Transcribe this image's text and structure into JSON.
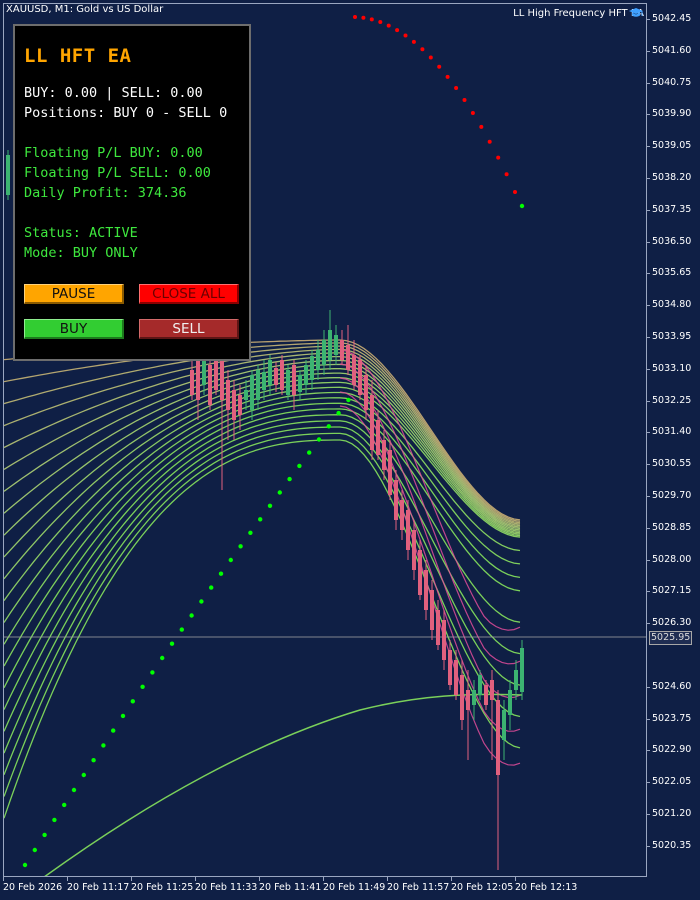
{
  "chart": {
    "title": "XAUUSD, M1:  Gold vs US Dollar",
    "ea_name": "LL High Frequency HFT EA",
    "ea_icon": "graduation-cap-icon",
    "current_price": "5025.95",
    "colors": {
      "background": "#0f1f45",
      "bull_candle": "#3cb371",
      "bear_candle": "#e0607e",
      "buy_dots": "#00ff00",
      "sell_dots": "#ff0000",
      "ribbon_green": "#7ad05a",
      "ribbon_tan": "#b8a070",
      "ribbon_pink": "#e04c9a"
    },
    "price_axis": [
      "5042.45",
      "5041.60",
      "5040.75",
      "5039.90",
      "5039.05",
      "5038.20",
      "5037.35",
      "5036.50",
      "5035.65",
      "5034.80",
      "5033.95",
      "5033.10",
      "5032.25",
      "5031.40",
      "5030.55",
      "5029.70",
      "5028.85",
      "5028.00",
      "5027.15",
      "5026.30",
      "5024.60",
      "5023.75",
      "5022.90",
      "5022.05",
      "5021.20",
      "5020.35"
    ],
    "time_axis": [
      "20 Feb 2026",
      "20 Feb 11:17",
      "20 Feb 11:25",
      "20 Feb 11:33",
      "20 Feb 11:41",
      "20 Feb 11:49",
      "20 Feb 11:57",
      "20 Feb 12:05",
      "20 Feb 12:13"
    ]
  },
  "panel": {
    "title": "LL HFT EA",
    "lots_line": "BUY: 0.00 | SELL: 0.00",
    "positions_line": "Positions: BUY 0 - SELL 0",
    "floating_buy": "Floating P/L BUY: 0.00",
    "floating_sell": "Floating P/L SELL: 0.00",
    "daily_profit": "Daily Profit: 374.36",
    "status": "Status: ACTIVE",
    "mode": "Mode: BUY ONLY",
    "buttons": {
      "pause": "PAUSE",
      "close_all": "CLOSE ALL",
      "buy": "BUY",
      "sell": "SELL"
    }
  }
}
